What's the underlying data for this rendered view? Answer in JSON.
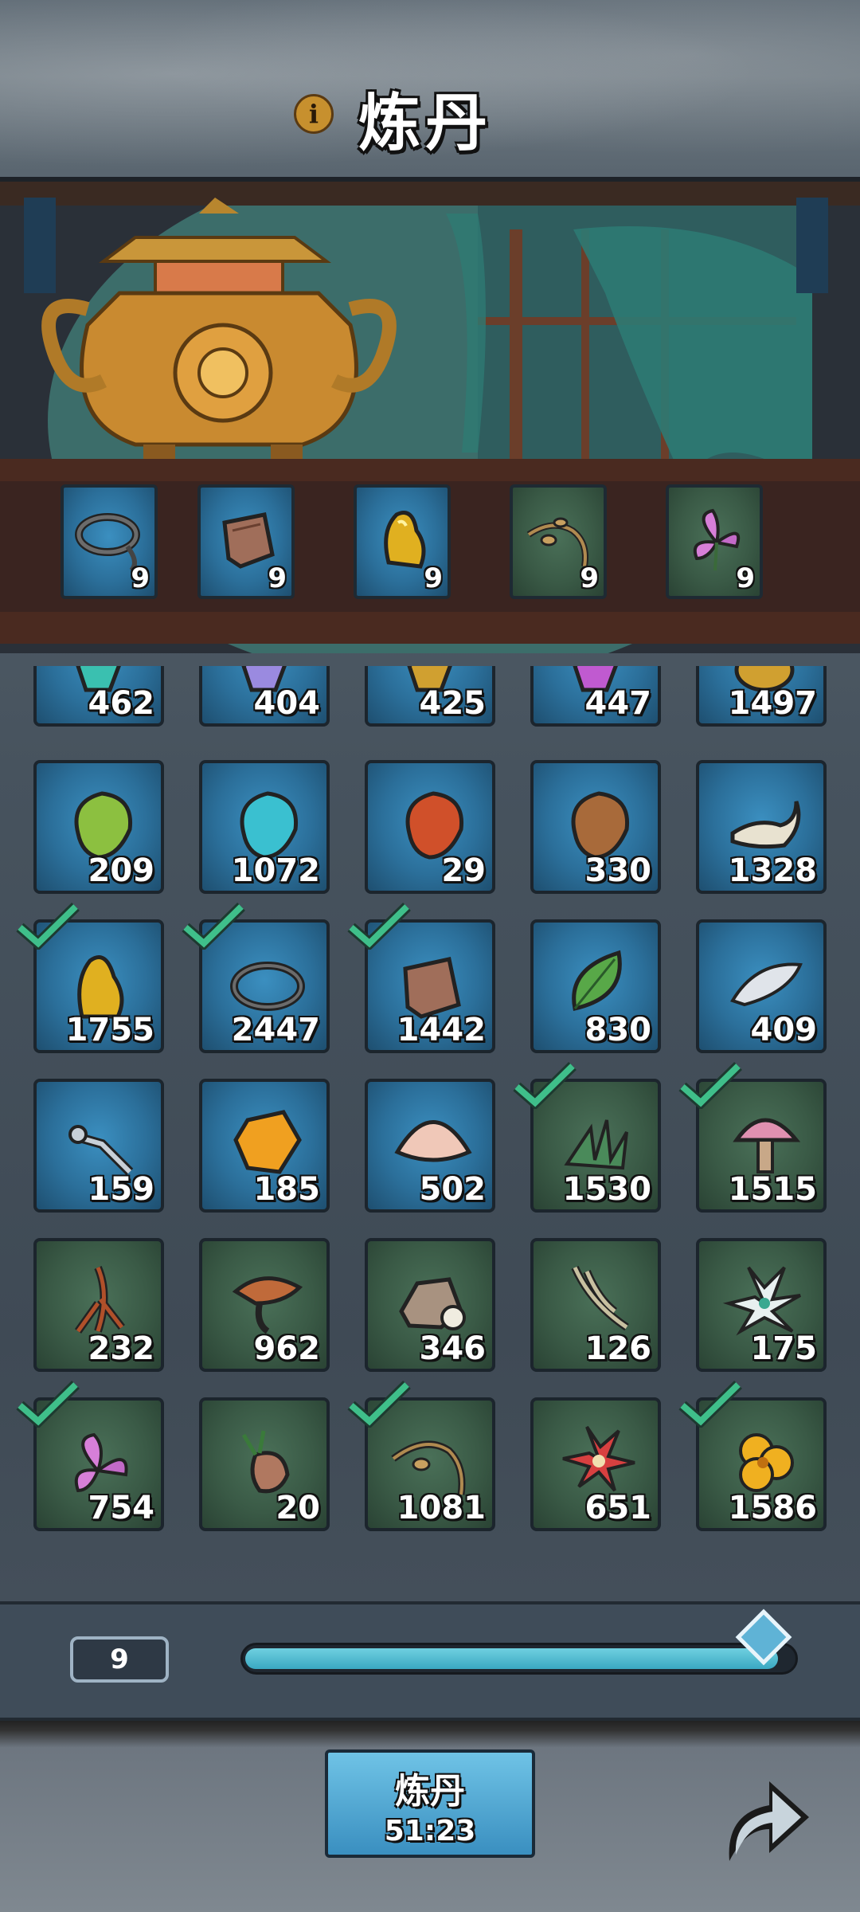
{
  "header": {
    "title": "炼丹",
    "info_icon": "info-icon"
  },
  "furnace_slots": [
    {
      "icon": "rope-icon",
      "count": "9",
      "bg": "blue"
    },
    {
      "icon": "leather-scrap-icon",
      "count": "9",
      "bg": "blue"
    },
    {
      "icon": "gold-nugget-icon",
      "count": "9",
      "bg": "blue"
    },
    {
      "icon": "root-vine-icon",
      "count": "9",
      "bg": "green"
    },
    {
      "icon": "purple-flower-icon",
      "count": "9",
      "bg": "green"
    }
  ],
  "inventory": [
    {
      "icon": "teal-crystal-icon",
      "count": "462",
      "bg": "blue",
      "selected": false
    },
    {
      "icon": "purple-crystal-icon",
      "count": "404",
      "bg": "blue",
      "selected": false
    },
    {
      "icon": "gold-crystal-icon",
      "count": "425",
      "bg": "blue",
      "selected": false
    },
    {
      "icon": "pink-crystal-icon",
      "count": "447",
      "bg": "blue",
      "selected": false
    },
    {
      "icon": "amber-ore-icon",
      "count": "1497",
      "bg": "blue",
      "selected": false
    },
    {
      "icon": "green-stone-icon",
      "count": "209",
      "bg": "blue",
      "selected": false
    },
    {
      "icon": "cyan-stone-icon",
      "count": "1072",
      "bg": "blue",
      "selected": false
    },
    {
      "icon": "red-stone-icon",
      "count": "29",
      "bg": "blue",
      "selected": false
    },
    {
      "icon": "brown-stone-icon",
      "count": "330",
      "bg": "blue",
      "selected": false
    },
    {
      "icon": "horn-icon",
      "count": "1328",
      "bg": "blue",
      "selected": false
    },
    {
      "icon": "gold-nugget-icon",
      "count": "1755",
      "bg": "blue",
      "selected": true
    },
    {
      "icon": "rope-icon",
      "count": "2447",
      "bg": "blue",
      "selected": true
    },
    {
      "icon": "leather-scrap-icon",
      "count": "1442",
      "bg": "blue",
      "selected": true
    },
    {
      "icon": "leaf-icon",
      "count": "830",
      "bg": "blue",
      "selected": false
    },
    {
      "icon": "feather-icon",
      "count": "409",
      "bg": "blue",
      "selected": false
    },
    {
      "icon": "bone-staff-icon",
      "count": "159",
      "bg": "blue",
      "selected": false
    },
    {
      "icon": "amber-gem-icon",
      "count": "185",
      "bg": "blue",
      "selected": false
    },
    {
      "icon": "seashell-icon",
      "count": "502",
      "bg": "blue",
      "selected": false
    },
    {
      "icon": "grass-herb-icon",
      "count": "1530",
      "bg": "green",
      "selected": true
    },
    {
      "icon": "pink-mushroom-icon",
      "count": "1515",
      "bg": "green",
      "selected": true
    },
    {
      "icon": "ginseng-root-icon",
      "count": "232",
      "bg": "green",
      "selected": false
    },
    {
      "icon": "lingzhi-mushroom-icon",
      "count": "962",
      "bg": "green",
      "selected": false
    },
    {
      "icon": "rock-pearl-icon",
      "count": "346",
      "bg": "green",
      "selected": false
    },
    {
      "icon": "twig-icon",
      "count": "126",
      "bg": "green",
      "selected": false
    },
    {
      "icon": "white-lotus-icon",
      "count": "175",
      "bg": "green",
      "selected": false
    },
    {
      "icon": "purple-flower-icon",
      "count": "754",
      "bg": "green",
      "selected": true
    },
    {
      "icon": "tuber-root-icon",
      "count": "20",
      "bg": "green",
      "selected": false
    },
    {
      "icon": "root-vine-icon",
      "count": "1081",
      "bg": "green",
      "selected": true
    },
    {
      "icon": "red-flower-icon",
      "count": "651",
      "bg": "green",
      "selected": false
    },
    {
      "icon": "yellow-flower-icon",
      "count": "1586",
      "bg": "green",
      "selected": true
    }
  ],
  "quantity": {
    "value": "9",
    "slider_fraction": 0.97
  },
  "craft_button": {
    "label": "炼丹",
    "timer": "51:23"
  },
  "share_icon": "share-arrow-icon",
  "colors": {
    "blue_cell": "#2b6f9a",
    "green_cell": "#3a5a46",
    "check": "#3fbf8a",
    "accent": "#5fb3d6"
  }
}
